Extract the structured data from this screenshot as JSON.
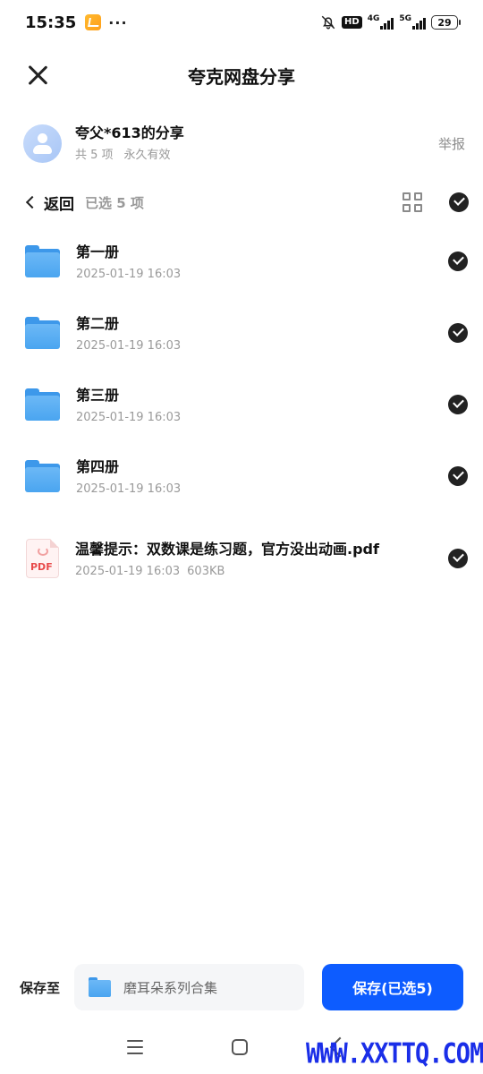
{
  "status_bar": {
    "time": "15:35",
    "dots": "···",
    "hd": "HD",
    "net1": "4G",
    "net2": "5G",
    "battery": "29"
  },
  "header": {
    "title": "夸克网盘分享"
  },
  "sharer": {
    "name": "夸父*613的分享",
    "count": "共 5 项",
    "validity": "永久有效",
    "report": "举报"
  },
  "toolbar": {
    "back": "返回",
    "selected": "已选 5 项"
  },
  "files": [
    {
      "name": "第一册",
      "time": "2025-01-19 16:03",
      "size": "",
      "type": "folder"
    },
    {
      "name": "第二册",
      "time": "2025-01-19 16:03",
      "size": "",
      "type": "folder"
    },
    {
      "name": "第三册",
      "time": "2025-01-19 16:03",
      "size": "",
      "type": "folder"
    },
    {
      "name": "第四册",
      "time": "2025-01-19 16:03",
      "size": "",
      "type": "folder"
    },
    {
      "name": "温馨提示：双数课是练习题，官方没出动画.pdf",
      "time": "2025-01-19 16:03",
      "size": "603KB",
      "type": "pdf"
    }
  ],
  "pdf_icon_label": "PDF",
  "bottom": {
    "save_to": "保存至",
    "destination": "磨耳朵系列合集",
    "save_button": "保存(已选5)"
  },
  "watermark": "WWW.XXTTQ.COM",
  "colors": {
    "primary": "#0d5cff",
    "folder": "#4aa5f0",
    "check": "#222222",
    "watermark": "#1a2ee8"
  }
}
